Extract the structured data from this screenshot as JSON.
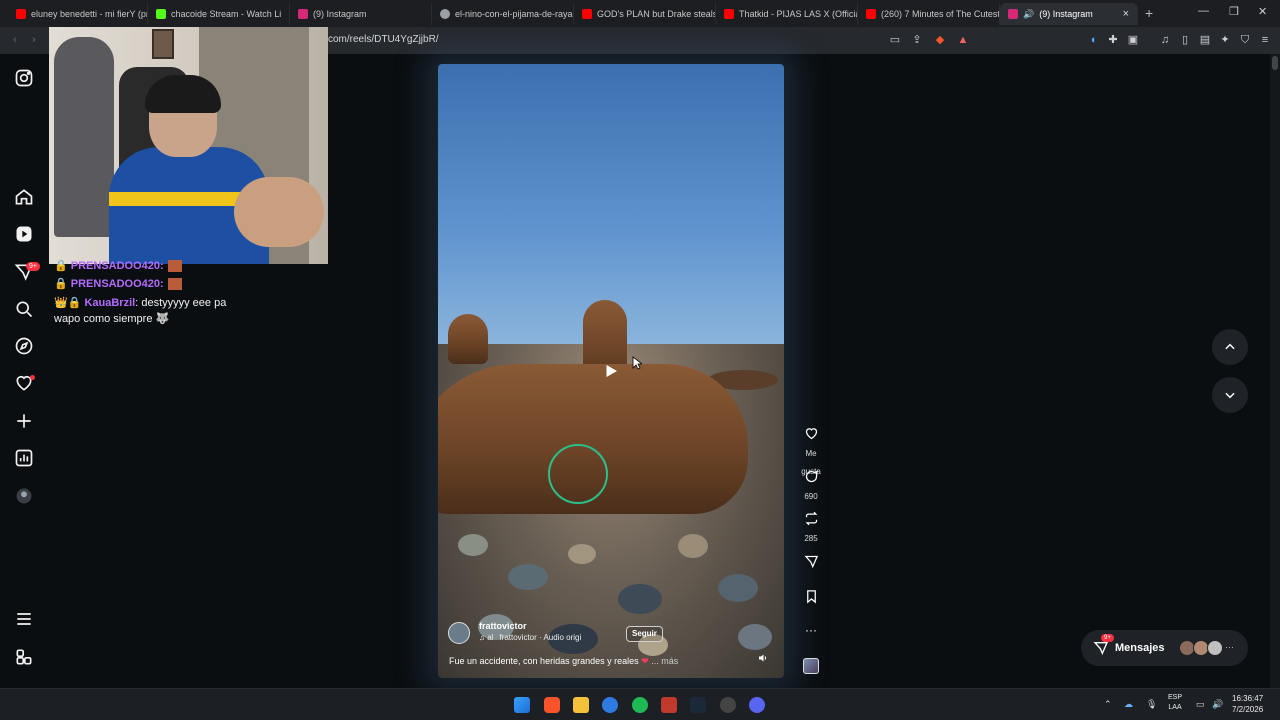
{
  "tabs": [
    {
      "title": "eluney benedetti - mi fierY (pro",
      "favicon_color": "#ff0000"
    },
    {
      "title": "chacoide Stream - Watch Li",
      "favicon_color": "#53fc18"
    },
    {
      "title": "(9) Instagram",
      "favicon_color": "#d62976"
    },
    {
      "title": "el-nino-con-el-pijama-de-raya",
      "favicon_color": "#9aa0a6"
    },
    {
      "title": "GOD's PLAN but Drake steals a",
      "favicon_color": "#ff0000"
    },
    {
      "title": "Thatkid - PIJAS LAS X (Official",
      "favicon_color": "#ff0000"
    },
    {
      "title": "(260) 7 Minutes of The Cutest",
      "favicon_color": "#ff0000"
    },
    {
      "title": "(9) Instagram",
      "favicon_color": "#d62976",
      "active": true
    }
  ],
  "address": {
    "url": "com/reels/DTU4YgZjjbR/"
  },
  "nav": {
    "notification_badge": "9+",
    "icons": [
      "instagram-logo-icon",
      "home-icon",
      "reels-icon",
      "messages-icon",
      "search-icon",
      "explore-icon",
      "notifications-icon",
      "create-icon",
      "dashboard-icon",
      "profile-icon",
      "menu-icon",
      "meta-icon"
    ]
  },
  "chat": [
    {
      "user": "PRENSADOO420:",
      "text": ""
    },
    {
      "user": "PRENSADOO420:",
      "text": ""
    },
    {
      "user": "KauaBrzil",
      "text": ": destyyyyy eee pa wapo como siempre"
    }
  ],
  "reel": {
    "author": "frattovictor",
    "audio_prefix": "♫ al",
    "audio": "frattovictor · Audio origi",
    "follow_label": "Seguir",
    "caption": "Fue un accidente, con heridas grandes y reales",
    "more": "... más"
  },
  "actions": {
    "like_label": "Me gusta",
    "comments": "690",
    "reposts": "285"
  },
  "messages": {
    "label": "Mensajes",
    "badge": "9+"
  },
  "taskbar": {
    "lang_line1": "ESP",
    "lang_line2": "LAA",
    "time": "16:36:47",
    "date": "7/2/2026"
  },
  "colors": {
    "accent": "#ff3040",
    "rope": "#2bbf8a",
    "page_bg": "#0b0e11"
  }
}
